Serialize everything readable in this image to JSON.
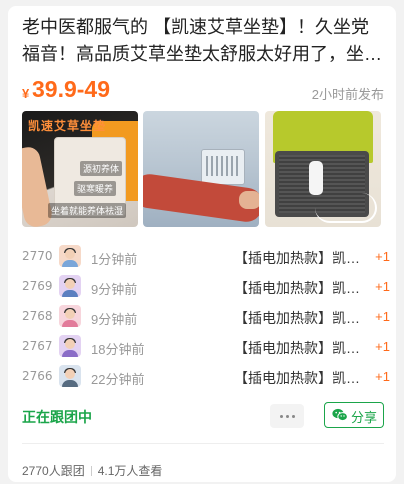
{
  "post": {
    "title": "老中医都服气的 【凯速艾草坐垫】！久坐党福音！高品质艾草坐垫太舒服太好用了，坐着就很舒服",
    "price_symbol": "¥",
    "price": "39.9-49",
    "posted_time": "2小时前发布"
  },
  "images": [
    {
      "headline": "凯速艾草坐垫",
      "tags": [
        "源初养体",
        "驱寒暖养",
        "坐着就能养体祛湿"
      ]
    },
    {},
    {}
  ],
  "joins": [
    {
      "num": "2770",
      "time": "1分钟前",
      "product": "【插电加热款】凯速艾草坐垫",
      "plus": "+1",
      "avatar_color": "#f6d9c8"
    },
    {
      "num": "2769",
      "time": "9分钟前",
      "product": "【插电加热款】凯速艾草坐垫",
      "plus": "+1",
      "avatar_color": "#e3d2f2"
    },
    {
      "num": "2768",
      "time": "9分钟前",
      "product": "【插电加热款】凯速艾草坐垫",
      "plus": "+1",
      "avatar_color": "#f7d5dc"
    },
    {
      "num": "2767",
      "time": "18分钟前",
      "product": "【插电加热款】凯速艾草坐垫",
      "plus": "+1",
      "avatar_color": "#e3d2f2"
    },
    {
      "num": "2766",
      "time": "22分钟前",
      "product": "【插电加热款】凯速艾草坐垫",
      "plus": "+1",
      "avatar_color": "#d9e3ee"
    }
  ],
  "footer": {
    "status": "正在跟团中",
    "share_label": "分享",
    "followers": "2770人跟团",
    "views": "4.1万人查看"
  },
  "colors": {
    "accent": "#ff6a1a",
    "green": "#1ba54a"
  }
}
